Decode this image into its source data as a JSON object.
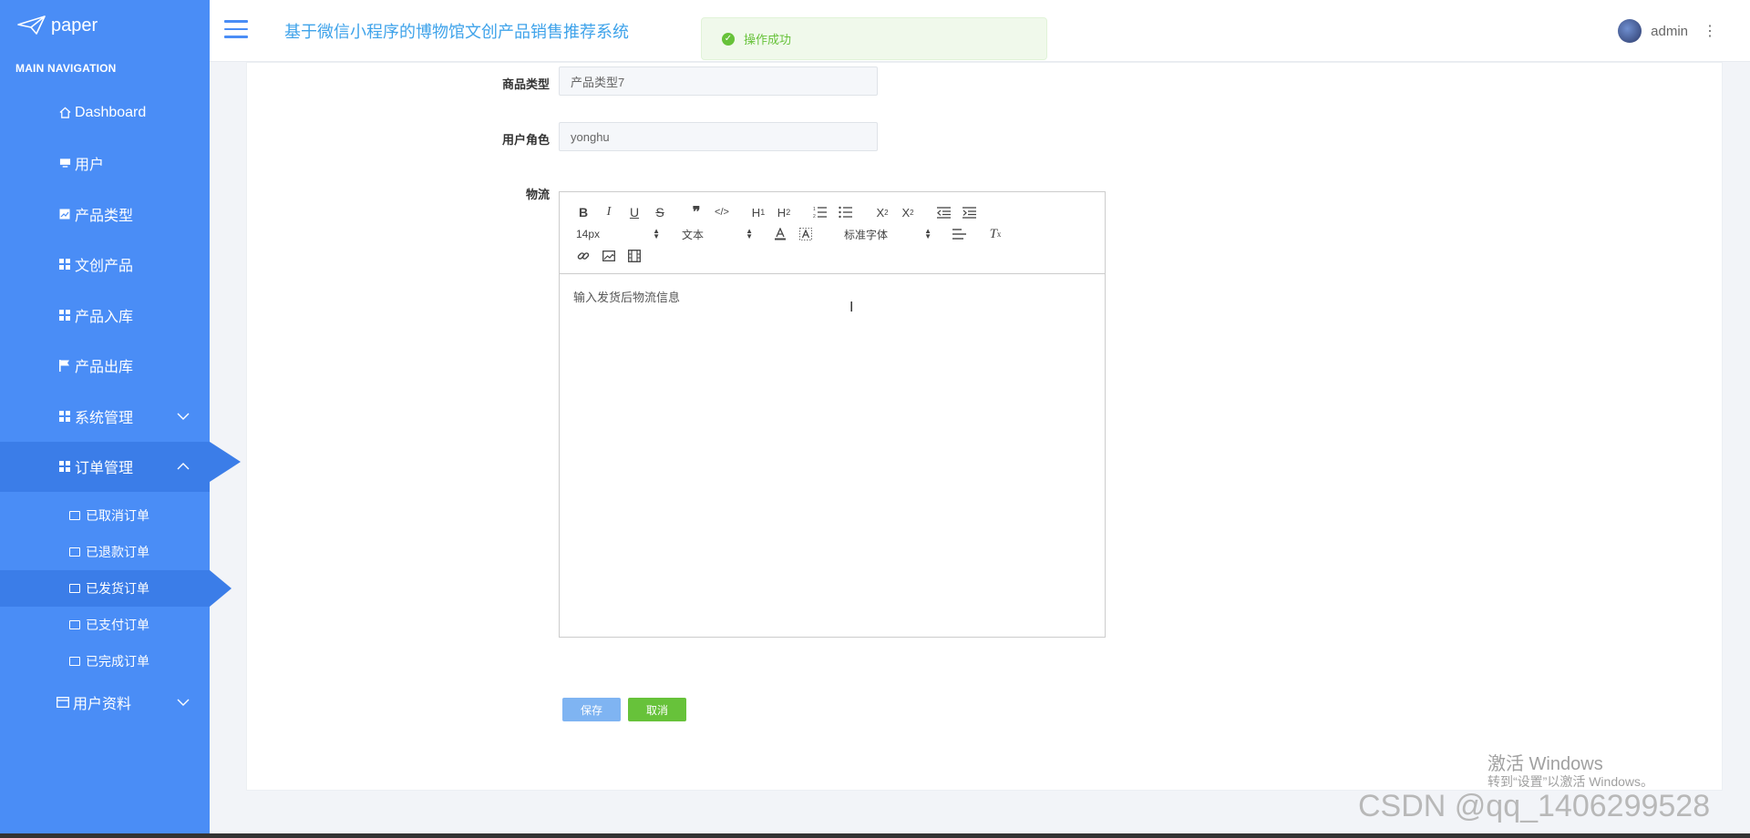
{
  "sidebar": {
    "logo_text": "paper",
    "nav_header": "MAIN NAVIGATION",
    "items": [
      {
        "label": "Dashboard",
        "icon": "home-icon"
      },
      {
        "label": "用户",
        "icon": "monitor-icon"
      },
      {
        "label": "产品类型",
        "icon": "image-icon"
      },
      {
        "label": "文创产品",
        "icon": "grid-icon"
      },
      {
        "label": "产品入库",
        "icon": "grid-icon"
      },
      {
        "label": "产品出库",
        "icon": "flag-icon"
      },
      {
        "label": "系统管理",
        "icon": "grid-icon"
      },
      {
        "label": "订单管理",
        "icon": "grid-icon"
      }
    ],
    "sub_items": [
      {
        "label": "已取消订单"
      },
      {
        "label": "已退款订单"
      },
      {
        "label": "已发货订单"
      },
      {
        "label": "已支付订单"
      },
      {
        "label": "已完成订单"
      }
    ],
    "last_item": {
      "label": "用户资料",
      "icon": "card-icon"
    }
  },
  "header": {
    "title": "基于微信小程序的博物馆文创产品销售推荐系统",
    "toast": "操作成功",
    "username": "admin"
  },
  "form": {
    "product_type_label": "商品类型",
    "product_type_value": "产品类型7",
    "user_role_label": "用户角色",
    "user_role_value": "yonghu",
    "logistics_label": "物流",
    "editor": {
      "font_size": "14px",
      "text_format": "文本",
      "font_family": "标准字体",
      "placeholder": "输入发货后物流信息"
    },
    "save_label": "保存",
    "cancel_label": "取消"
  },
  "watermark": {
    "line1": "激活 Windows",
    "line2": "转到“设置”以激活 Windows。",
    "csdn": "CSDN @qq_1406299528"
  }
}
